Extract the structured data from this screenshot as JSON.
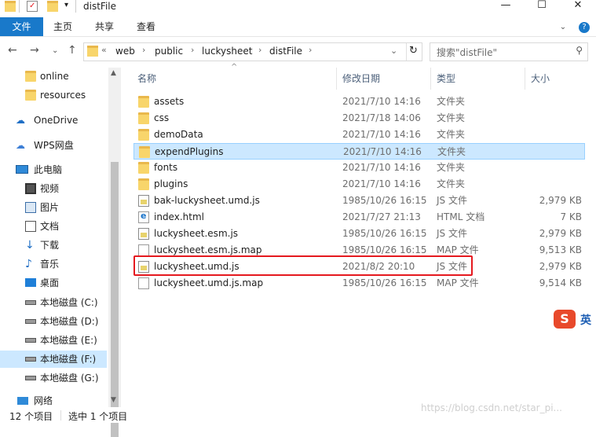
{
  "window": {
    "title": "distFile",
    "controls": {
      "minimize": "—",
      "maximize": "☐",
      "close": "✕"
    }
  },
  "ribbon": {
    "tabs": [
      "文件",
      "主页",
      "共享",
      "查看"
    ],
    "help": "?"
  },
  "address": {
    "breadcrumbs": [
      "web",
      "public",
      "luckysheet",
      "distFile"
    ],
    "overflow": "«",
    "search_placeholder": "搜索\"distFile\""
  },
  "nav": {
    "items": [
      {
        "label": "online",
        "icon": "folder-icon"
      },
      {
        "label": "resources",
        "icon": "folder-icon"
      },
      {
        "label": "OneDrive",
        "icon": "cloud-icon"
      },
      {
        "label": "WPS网盘",
        "icon": "cloud-icon"
      },
      {
        "label": "此电脑",
        "icon": "computer-icon"
      },
      {
        "label": "视频",
        "icon": "video-icon"
      },
      {
        "label": "图片",
        "icon": "picture-icon"
      },
      {
        "label": "文档",
        "icon": "document-icon"
      },
      {
        "label": "下载",
        "icon": "download-icon"
      },
      {
        "label": "音乐",
        "icon": "music-icon"
      },
      {
        "label": "桌面",
        "icon": "desktop-icon"
      },
      {
        "label": "本地磁盘 (C:)",
        "icon": "drive-icon"
      },
      {
        "label": "本地磁盘 (D:)",
        "icon": "drive-icon"
      },
      {
        "label": "本地磁盘 (E:)",
        "icon": "drive-icon"
      },
      {
        "label": "本地磁盘 (F:)",
        "icon": "drive-icon"
      },
      {
        "label": "本地磁盘 (G:)",
        "icon": "drive-icon"
      },
      {
        "label": "网络",
        "icon": "network-icon"
      }
    ]
  },
  "columns": {
    "name": "名称",
    "date": "修改日期",
    "type": "类型",
    "size": "大小"
  },
  "files": [
    {
      "name": "assets",
      "date": "2021/7/10 14:16",
      "type": "文件夹",
      "size": "",
      "kind": "folder"
    },
    {
      "name": "css",
      "date": "2021/7/18 14:06",
      "type": "文件夹",
      "size": "",
      "kind": "folder"
    },
    {
      "name": "demoData",
      "date": "2021/7/10 14:16",
      "type": "文件夹",
      "size": "",
      "kind": "folder"
    },
    {
      "name": "expendPlugins",
      "date": "2021/7/10 14:16",
      "type": "文件夹",
      "size": "",
      "kind": "folder"
    },
    {
      "name": "fonts",
      "date": "2021/7/10 14:16",
      "type": "文件夹",
      "size": "",
      "kind": "folder"
    },
    {
      "name": "plugins",
      "date": "2021/7/10 14:16",
      "type": "文件夹",
      "size": "",
      "kind": "folder"
    },
    {
      "name": "bak-luckysheet.umd.js",
      "date": "1985/10/26 16:15",
      "type": "JS 文件",
      "size": "2,979 KB",
      "kind": "js"
    },
    {
      "name": "index.html",
      "date": "2021/7/27 21:13",
      "type": "HTML 文档",
      "size": "7 KB",
      "kind": "html"
    },
    {
      "name": "luckysheet.esm.js",
      "date": "1985/10/26 16:15",
      "type": "JS 文件",
      "size": "2,979 KB",
      "kind": "js"
    },
    {
      "name": "luckysheet.esm.js.map",
      "date": "1985/10/26 16:15",
      "type": "MAP 文件",
      "size": "9,513 KB",
      "kind": "map"
    },
    {
      "name": "luckysheet.umd.js",
      "date": "2021/8/2 20:10",
      "type": "JS 文件",
      "size": "2,979 KB",
      "kind": "js"
    },
    {
      "name": "luckysheet.umd.js.map",
      "date": "1985/10/26 16:15",
      "type": "MAP 文件",
      "size": "9,514 KB",
      "kind": "map"
    }
  ],
  "status": {
    "count": "12 个项目",
    "selected": "选中 1 个项目"
  },
  "watermark": "https://blog.csdn.net/star_pi...",
  "ime": {
    "label": "英"
  },
  "colors": {
    "accent": "#1979ca",
    "selection": "#cce8ff",
    "highlight": "#e5191f"
  }
}
